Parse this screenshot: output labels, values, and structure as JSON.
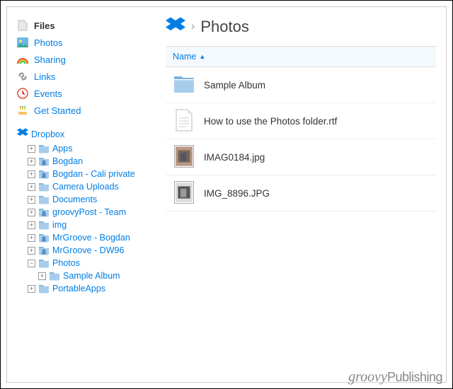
{
  "sidebar": {
    "nav": [
      {
        "label": "Files",
        "icon": "file-icon",
        "active": true
      },
      {
        "label": "Photos",
        "icon": "photo-icon",
        "active": false
      },
      {
        "label": "Sharing",
        "icon": "rainbow-icon",
        "active": false
      },
      {
        "label": "Links",
        "icon": "link-icon",
        "active": false
      },
      {
        "label": "Events",
        "icon": "clock-icon",
        "active": false
      },
      {
        "label": "Get Started",
        "icon": "cake-icon",
        "active": false
      }
    ],
    "tree_root_label": "Dropbox",
    "tree": [
      {
        "label": "Apps",
        "shared": false,
        "expanded": false
      },
      {
        "label": "Bogdan",
        "shared": true,
        "expanded": false
      },
      {
        "label": "Bogdan - Cali private",
        "shared": true,
        "expanded": false
      },
      {
        "label": "Camera Uploads",
        "shared": false,
        "expanded": false
      },
      {
        "label": "Documents",
        "shared": false,
        "expanded": false
      },
      {
        "label": "groovyPost - Team",
        "shared": true,
        "expanded": false
      },
      {
        "label": "img",
        "shared": false,
        "expanded": false
      },
      {
        "label": "MrGroove - Bogdan",
        "shared": true,
        "expanded": false
      },
      {
        "label": "MrGroove - DW96",
        "shared": true,
        "expanded": false
      },
      {
        "label": "Photos",
        "shared": false,
        "expanded": true,
        "children": [
          {
            "label": "Sample Album",
            "shared": false,
            "expanded": false
          }
        ]
      },
      {
        "label": "PortableApps",
        "shared": false,
        "expanded": false
      }
    ]
  },
  "breadcrumb": {
    "sep": "›",
    "title": "Photos"
  },
  "column_header": {
    "name": "Name",
    "sort_indicator": "▲"
  },
  "files": [
    {
      "name": "Sample Album",
      "kind": "folder"
    },
    {
      "name": "How to use the Photos folder.rtf",
      "kind": "doc"
    },
    {
      "name": "IMAG0184.jpg",
      "kind": "image",
      "palette": [
        "#b98",
        "#765",
        "#556"
      ]
    },
    {
      "name": "IMG_8896.JPG",
      "kind": "image",
      "palette": [
        "#ddd",
        "#555",
        "#999"
      ]
    }
  ],
  "watermark": {
    "a": "groovy",
    "b": "Publishing"
  },
  "colors": {
    "link": "#007ee5",
    "folder": "#a8cdec",
    "folder_dark": "#7bb4e0"
  }
}
